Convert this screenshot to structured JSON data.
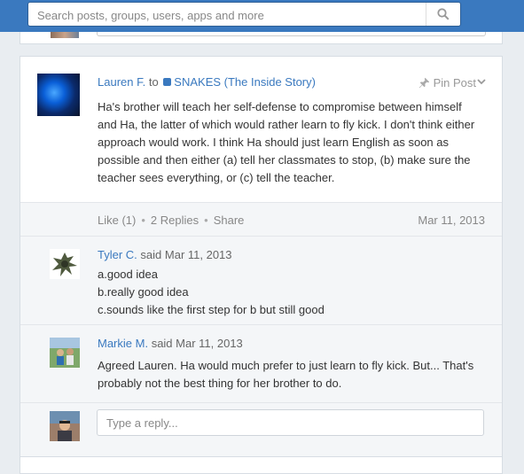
{
  "search": {
    "placeholder": "Search posts, groups, users, apps and more"
  },
  "post": {
    "author": "Lauren F.",
    "to_word": "to",
    "group": "SNAKES (The Inside Story)",
    "pin_label": "Pin Post",
    "body": "Ha's brother will teach her self-defense to compromise between himself and Ha, the latter of which would rather learn to fly kick. I don't think either approach would work. I think Ha should just learn English as soon as possible and then either (a) tell her classmates to stop, (b) make sure the teacher sees everything, or (c) tell the teacher.",
    "like": "Like (1)",
    "replies": "2 Replies",
    "share": "Share",
    "date": "Mar 11, 2013"
  },
  "replies": [
    {
      "author": "Tyler C.",
      "said": "said Mar 11, 2013",
      "lines": [
        "a.good idea",
        "b.really good idea",
        "c.sounds like the first step for b but still good"
      ]
    },
    {
      "author": "Markie M.",
      "said": "said Mar 11, 2013",
      "lines": [
        "Agreed Lauren. Ha would much prefer to just learn to fly kick. But... That's",
        "probably not the best thing for her brother to do."
      ]
    }
  ],
  "reply_box": {
    "placeholder": "Type a reply..."
  },
  "icons": {
    "search": "search-icon",
    "pin": "pin-icon",
    "chevron": "chevron-down-icon"
  },
  "colors": {
    "brand": "#3a79bf",
    "link": "#3a79bf",
    "muted": "#888888",
    "background": "#e9edf1"
  }
}
